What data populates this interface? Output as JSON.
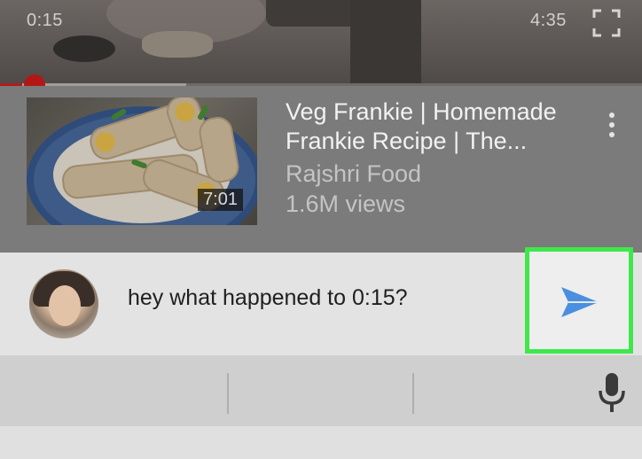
{
  "player": {
    "current_time": "0:15",
    "duration": "4:35",
    "progress_fraction": 0.035,
    "buffered_fraction": 0.29,
    "progress_color": "#b31a1a",
    "fullscreen_icon": "fullscreen-icon"
  },
  "video_card": {
    "title": "Veg Frankie | Homemade Frankie Recipe | The...",
    "channel": "Rajshri Food",
    "views": "1.6M views",
    "thumbnail_duration": "7:01",
    "menu_icon": "more-vert-icon"
  },
  "reply": {
    "message": "hey what happened to 0:15?",
    "send_icon": "send-icon",
    "send_color": "#4a8fe0",
    "highlight_color": "#3ee84b"
  },
  "keyboard": {
    "mic_icon": "microphone-icon"
  }
}
